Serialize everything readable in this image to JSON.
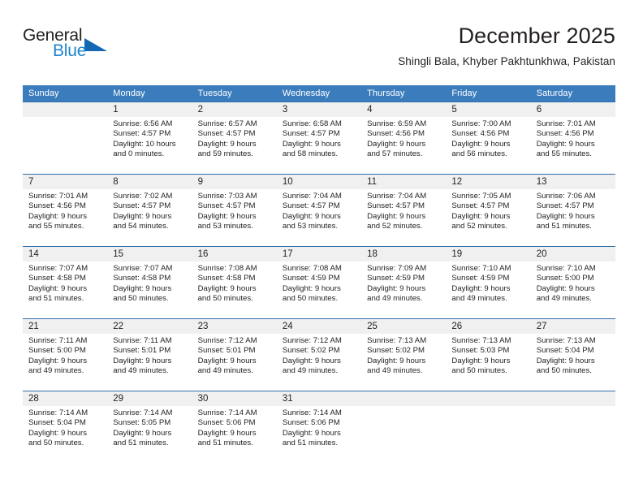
{
  "brand": {
    "name_part1": "General",
    "name_part2": "Blue"
  },
  "header": {
    "title": "December 2025",
    "subtitle": "Shingli Bala, Khyber Pakhtunkhwa, Pakistan"
  },
  "colors": {
    "header_blue": "#3b7cbd",
    "week_rule_blue": "#2f6fad",
    "date_band_gray": "#f0f0f0",
    "logo_blue": "#1d84cd",
    "text": "#231f20"
  },
  "weekdays": [
    "Sunday",
    "Monday",
    "Tuesday",
    "Wednesday",
    "Thursday",
    "Friday",
    "Saturday"
  ],
  "weeks": [
    [
      {
        "day": "",
        "sunrise": "",
        "sunset": "",
        "daylight1": "",
        "daylight2": ""
      },
      {
        "day": "1",
        "sunrise": "Sunrise: 6:56 AM",
        "sunset": "Sunset: 4:57 PM",
        "daylight1": "Daylight: 10 hours",
        "daylight2": "and 0 minutes."
      },
      {
        "day": "2",
        "sunrise": "Sunrise: 6:57 AM",
        "sunset": "Sunset: 4:57 PM",
        "daylight1": "Daylight: 9 hours",
        "daylight2": "and 59 minutes."
      },
      {
        "day": "3",
        "sunrise": "Sunrise: 6:58 AM",
        "sunset": "Sunset: 4:57 PM",
        "daylight1": "Daylight: 9 hours",
        "daylight2": "and 58 minutes."
      },
      {
        "day": "4",
        "sunrise": "Sunrise: 6:59 AM",
        "sunset": "Sunset: 4:56 PM",
        "daylight1": "Daylight: 9 hours",
        "daylight2": "and 57 minutes."
      },
      {
        "day": "5",
        "sunrise": "Sunrise: 7:00 AM",
        "sunset": "Sunset: 4:56 PM",
        "daylight1": "Daylight: 9 hours",
        "daylight2": "and 56 minutes."
      },
      {
        "day": "6",
        "sunrise": "Sunrise: 7:01 AM",
        "sunset": "Sunset: 4:56 PM",
        "daylight1": "Daylight: 9 hours",
        "daylight2": "and 55 minutes."
      }
    ],
    [
      {
        "day": "7",
        "sunrise": "Sunrise: 7:01 AM",
        "sunset": "Sunset: 4:56 PM",
        "daylight1": "Daylight: 9 hours",
        "daylight2": "and 55 minutes."
      },
      {
        "day": "8",
        "sunrise": "Sunrise: 7:02 AM",
        "sunset": "Sunset: 4:57 PM",
        "daylight1": "Daylight: 9 hours",
        "daylight2": "and 54 minutes."
      },
      {
        "day": "9",
        "sunrise": "Sunrise: 7:03 AM",
        "sunset": "Sunset: 4:57 PM",
        "daylight1": "Daylight: 9 hours",
        "daylight2": "and 53 minutes."
      },
      {
        "day": "10",
        "sunrise": "Sunrise: 7:04 AM",
        "sunset": "Sunset: 4:57 PM",
        "daylight1": "Daylight: 9 hours",
        "daylight2": "and 53 minutes."
      },
      {
        "day": "11",
        "sunrise": "Sunrise: 7:04 AM",
        "sunset": "Sunset: 4:57 PM",
        "daylight1": "Daylight: 9 hours",
        "daylight2": "and 52 minutes."
      },
      {
        "day": "12",
        "sunrise": "Sunrise: 7:05 AM",
        "sunset": "Sunset: 4:57 PM",
        "daylight1": "Daylight: 9 hours",
        "daylight2": "and 52 minutes."
      },
      {
        "day": "13",
        "sunrise": "Sunrise: 7:06 AM",
        "sunset": "Sunset: 4:57 PM",
        "daylight1": "Daylight: 9 hours",
        "daylight2": "and 51 minutes."
      }
    ],
    [
      {
        "day": "14",
        "sunrise": "Sunrise: 7:07 AM",
        "sunset": "Sunset: 4:58 PM",
        "daylight1": "Daylight: 9 hours",
        "daylight2": "and 51 minutes."
      },
      {
        "day": "15",
        "sunrise": "Sunrise: 7:07 AM",
        "sunset": "Sunset: 4:58 PM",
        "daylight1": "Daylight: 9 hours",
        "daylight2": "and 50 minutes."
      },
      {
        "day": "16",
        "sunrise": "Sunrise: 7:08 AM",
        "sunset": "Sunset: 4:58 PM",
        "daylight1": "Daylight: 9 hours",
        "daylight2": "and 50 minutes."
      },
      {
        "day": "17",
        "sunrise": "Sunrise: 7:08 AM",
        "sunset": "Sunset: 4:59 PM",
        "daylight1": "Daylight: 9 hours",
        "daylight2": "and 50 minutes."
      },
      {
        "day": "18",
        "sunrise": "Sunrise: 7:09 AM",
        "sunset": "Sunset: 4:59 PM",
        "daylight1": "Daylight: 9 hours",
        "daylight2": "and 49 minutes."
      },
      {
        "day": "19",
        "sunrise": "Sunrise: 7:10 AM",
        "sunset": "Sunset: 4:59 PM",
        "daylight1": "Daylight: 9 hours",
        "daylight2": "and 49 minutes."
      },
      {
        "day": "20",
        "sunrise": "Sunrise: 7:10 AM",
        "sunset": "Sunset: 5:00 PM",
        "daylight1": "Daylight: 9 hours",
        "daylight2": "and 49 minutes."
      }
    ],
    [
      {
        "day": "21",
        "sunrise": "Sunrise: 7:11 AM",
        "sunset": "Sunset: 5:00 PM",
        "daylight1": "Daylight: 9 hours",
        "daylight2": "and 49 minutes."
      },
      {
        "day": "22",
        "sunrise": "Sunrise: 7:11 AM",
        "sunset": "Sunset: 5:01 PM",
        "daylight1": "Daylight: 9 hours",
        "daylight2": "and 49 minutes."
      },
      {
        "day": "23",
        "sunrise": "Sunrise: 7:12 AM",
        "sunset": "Sunset: 5:01 PM",
        "daylight1": "Daylight: 9 hours",
        "daylight2": "and 49 minutes."
      },
      {
        "day": "24",
        "sunrise": "Sunrise: 7:12 AM",
        "sunset": "Sunset: 5:02 PM",
        "daylight1": "Daylight: 9 hours",
        "daylight2": "and 49 minutes."
      },
      {
        "day": "25",
        "sunrise": "Sunrise: 7:13 AM",
        "sunset": "Sunset: 5:02 PM",
        "daylight1": "Daylight: 9 hours",
        "daylight2": "and 49 minutes."
      },
      {
        "day": "26",
        "sunrise": "Sunrise: 7:13 AM",
        "sunset": "Sunset: 5:03 PM",
        "daylight1": "Daylight: 9 hours",
        "daylight2": "and 50 minutes."
      },
      {
        "day": "27",
        "sunrise": "Sunrise: 7:13 AM",
        "sunset": "Sunset: 5:04 PM",
        "daylight1": "Daylight: 9 hours",
        "daylight2": "and 50 minutes."
      }
    ],
    [
      {
        "day": "28",
        "sunrise": "Sunrise: 7:14 AM",
        "sunset": "Sunset: 5:04 PM",
        "daylight1": "Daylight: 9 hours",
        "daylight2": "and 50 minutes."
      },
      {
        "day": "29",
        "sunrise": "Sunrise: 7:14 AM",
        "sunset": "Sunset: 5:05 PM",
        "daylight1": "Daylight: 9 hours",
        "daylight2": "and 51 minutes."
      },
      {
        "day": "30",
        "sunrise": "Sunrise: 7:14 AM",
        "sunset": "Sunset: 5:06 PM",
        "daylight1": "Daylight: 9 hours",
        "daylight2": "and 51 minutes."
      },
      {
        "day": "31",
        "sunrise": "Sunrise: 7:14 AM",
        "sunset": "Sunset: 5:06 PM",
        "daylight1": "Daylight: 9 hours",
        "daylight2": "and 51 minutes."
      },
      {
        "day": "",
        "sunrise": "",
        "sunset": "",
        "daylight1": "",
        "daylight2": ""
      },
      {
        "day": "",
        "sunrise": "",
        "sunset": "",
        "daylight1": "",
        "daylight2": ""
      },
      {
        "day": "",
        "sunrise": "",
        "sunset": "",
        "daylight1": "",
        "daylight2": ""
      }
    ]
  ]
}
